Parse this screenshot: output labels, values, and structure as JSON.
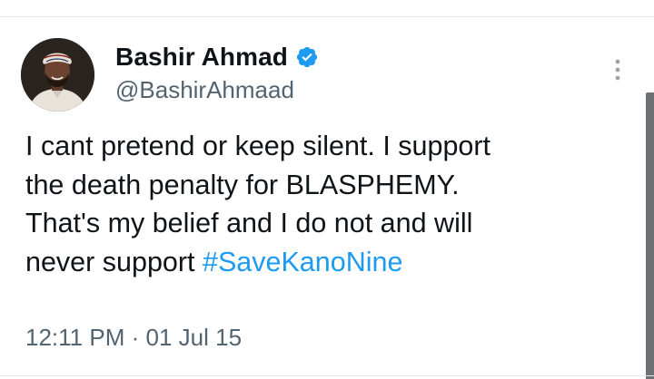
{
  "tweet": {
    "author": {
      "display_name": "Bashir Ahmad",
      "handle": "@BashirAhmaad",
      "verified_icon": "verified-badge-icon",
      "avatar": "profile-photo"
    },
    "text": {
      "line1": "I cant pretend or keep silent. I support",
      "line2": "the death penalty for BLASPHEMY.",
      "line3": "That's my belief and I do not and will",
      "line4_prefix": "never support ",
      "hashtag": "#SaveKanoNine"
    },
    "time": "12:11 PM",
    "separator": "·",
    "date": "01 Jul 15",
    "more_icon": "more-vertical-icon"
  },
  "colors": {
    "text": "#0f1419",
    "secondary": "#536471",
    "link": "#1d9bf0",
    "verified": "#1d9bf0"
  }
}
